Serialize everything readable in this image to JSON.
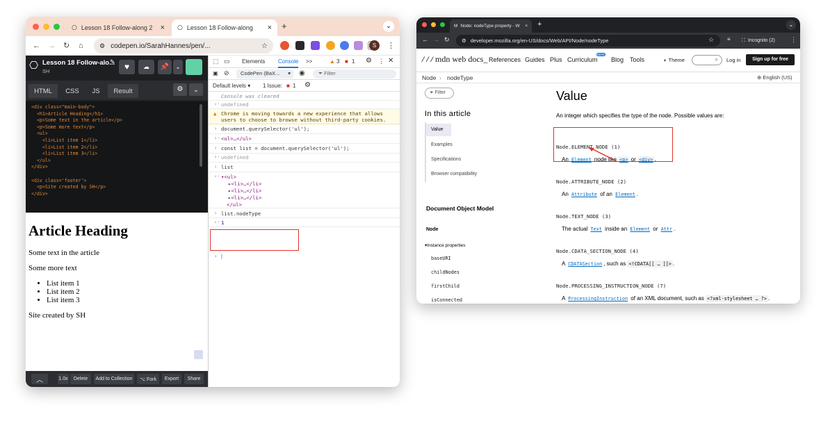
{
  "window1": {
    "tabs": [
      {
        "label": "Lesson 18 Follow-along 2",
        "close": "×"
      },
      {
        "label": "Lesson 18 Follow-along",
        "close": "×"
      }
    ],
    "new_tab": "+",
    "tab_menu": "⌄",
    "url": "codepen.io/SarahHannes/pen/...",
    "profile_letter": "S",
    "codepen": {
      "title": "Lesson 18 Follow-alo...",
      "author": "SH",
      "tabs": [
        "HTML",
        "CSS",
        "JS",
        "Result"
      ],
      "code_lines": [
        "<div class=\"main-body\">",
        "  <h1>Article Heading</h1>",
        "  <p>Some text in the article</p>",
        "  <p>Some more text</p>",
        "  <ul>",
        "    <li>List item 1</li>",
        "    <li>List item 2</li>",
        "    <li>List item 3</li>",
        "  </ul>",
        "</div>",
        "",
        "<div class='footer'>",
        "  <p>Site created by SH</p>",
        "</div>"
      ],
      "result": {
        "heading": "Article Heading",
        "p1": "Some text in the article",
        "p2": "Some more text",
        "list": [
          "List item 1",
          "List item 2",
          "List item 3"
        ],
        "footer": "Site created by SH"
      },
      "footer_buttons": [
        "1.0x",
        "Delete",
        "Add to Collection",
        "⌥ Fork",
        "Export",
        "Share"
      ]
    },
    "devtools": {
      "tabs": [
        "Elements",
        "Console"
      ],
      "more": ">>",
      "warnings": "3",
      "errors": "1",
      "context": "CodePen (BaX...",
      "filter_placeholder": "Filter",
      "levels": "Default levels ▾",
      "issues": "1 Issue:",
      "issues_count": "1",
      "console": {
        "cleared": "Console was cleared",
        "undefined1": "undefined",
        "warning": "Chrome is moving towards a new experience that allows users to choose to browse without third-party cookies.",
        "cmd1": "document.querySelector('ul');",
        "out1": "<ul>…</ul>",
        "cmd2": "const list = document.querySelector('ul');",
        "undefined2": "undefined",
        "cmd3": "list",
        "ul_open": "<ul>",
        "li_items": [
          "<li>…</li>",
          "<li>…</li>",
          "<li>…</li>"
        ],
        "ul_close": "</ul>",
        "cmd4": "list.nodeType",
        "out4": "1"
      }
    }
  },
  "window2": {
    "tab_title": "Node: nodeType property - W",
    "url": "developer.mozilla.org/en-US/docs/Web/API/Node/nodeType",
    "incognito": "Incognito (2)",
    "mdn": {
      "logo": "mdn web docs_",
      "nav": [
        "References",
        "Guides",
        "Plus",
        "Curriculum",
        "Blog",
        "Tools"
      ],
      "new_badge": "NEW",
      "theme": "Theme",
      "login": "Log in",
      "signup": "Sign up for free",
      "breadcrumb": [
        "Node",
        "nodeType"
      ],
      "language": "English (US)",
      "filter": "Filter",
      "in_this_article": "In this article",
      "toc": [
        "Value",
        "Examples",
        "Specifications",
        "Browser compatibility"
      ],
      "dom_title": "Document Object Model",
      "node_label": "Node",
      "instance_props": "Instance properties",
      "props": [
        "baseURI",
        "childNodes",
        "firstChild",
        "isConnected"
      ],
      "heading": "Value",
      "intro": "An integer which specifies the type of the node. Possible values are:",
      "values": [
        {
          "name": "Node.ELEMENT_NODE (1)",
          "parts": [
            "An ",
            "Element",
            " node like ",
            "<p>",
            " or ",
            "<div>",
            "."
          ]
        },
        {
          "name": "Node.ATTRIBUTE_NODE (2)",
          "parts": [
            "An ",
            "Attribute",
            " of an ",
            "Element",
            "."
          ]
        },
        {
          "name": "Node.TEXT_NODE (3)",
          "parts": [
            "The actual ",
            "Text",
            " inside an ",
            "Element",
            " or ",
            "Attr",
            "."
          ]
        },
        {
          "name": "Node.CDATA_SECTION_NODE (4)",
          "parts": [
            "A ",
            "CDATASection",
            ", such as ",
            "<!CDATA[[ … ]]>",
            "."
          ]
        },
        {
          "name": "Node.PROCESSING_INSTRUCTION_NODE (7)",
          "parts": [
            "A ",
            "ProcessingInstruction",
            " of an XML document, such as ",
            "<?xml-stylesheet … ?>",
            "."
          ]
        }
      ]
    }
  },
  "colors": {
    "accent_red": "#e0302a",
    "mdn_link": "#0069c2",
    "codepen_dark": "#1e1f23"
  }
}
